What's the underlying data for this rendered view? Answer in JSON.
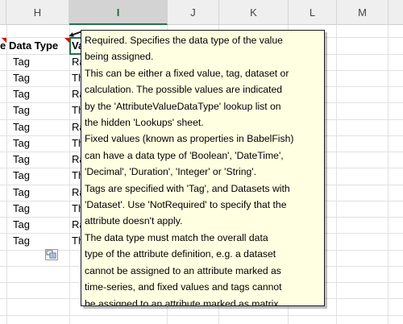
{
  "columns": {
    "H": "H",
    "I": "I",
    "J": "J",
    "K": "K",
    "L": "L",
    "M": "M"
  },
  "header_row": {
    "prev_fragment": "e",
    "data_type": "Data Type",
    "value_fragment": "Va"
  },
  "rows": [
    {
      "type": "Tag",
      "value_fragment": "Ra"
    },
    {
      "type": "Tag",
      "value_fragment": "Th"
    },
    {
      "type": "Tag",
      "value_fragment": "Ra"
    },
    {
      "type": "Tag",
      "value_fragment": "Th"
    },
    {
      "type": "Tag",
      "value_fragment": "Ra"
    },
    {
      "type": "Tag",
      "value_fragment": "Th"
    },
    {
      "type": "Tag",
      "value_fragment": "Ra"
    },
    {
      "type": "Tag",
      "value_fragment": "Th"
    },
    {
      "type": "Tag",
      "value_fragment": "Ra"
    },
    {
      "type": "Tag",
      "value_fragment": "Th"
    },
    {
      "type": "Tag",
      "value_fragment": "Ra"
    },
    {
      "type": "Tag",
      "value_fragment": "Th"
    }
  ],
  "comment": {
    "lines": [
      "Required. Specifies the data type of the value",
      "being assigned.",
      "This can be either a fixed value, tag, dataset or",
      "calculation. The possible values are indicated",
      "by the 'AttributeValueDataType' lookup list on",
      "the hidden 'Lookups' sheet.",
      "Fixed values (known as properties in BabelFish)",
      "can have a data type of 'Boolean', 'DateTime',",
      "'Decimal', 'Duration', 'Integer' or 'String'.",
      "Tags are specified with 'Tag', and Datasets with",
      "'Dataset'. Use 'NotRequired' to specify that the",
      "attribute doesn't apply.",
      "The data type must match the overall data",
      "type of the attribute definition, e.g. a dataset",
      "cannot be assigned to an attribute marked as",
      "time-series, and fixed values and tags cannot",
      "be assigned to an attribute marked as matrix."
    ]
  },
  "colors": {
    "comment_background": "#ffffe1",
    "selection_green": "#217346",
    "comment_indicator": "#e00000"
  },
  "icons": [
    "paste-options-icon",
    "comment-indicator-icon"
  ]
}
